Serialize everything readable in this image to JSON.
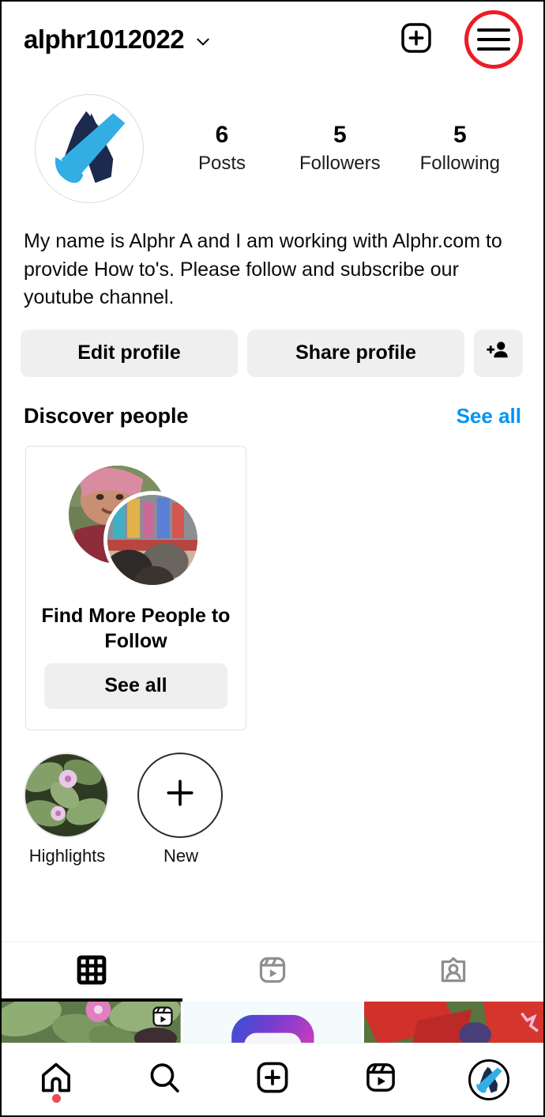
{
  "header": {
    "username": "alphr1012022",
    "chevron_icon": "chevron-down-icon",
    "create_icon": "plus-square-icon",
    "menu_icon": "hamburger-menu-icon",
    "highlight_color": "#ED1C24"
  },
  "profile": {
    "avatar_icon": "alphr-logo-avatar",
    "stats": [
      {
        "value": "6",
        "label": "Posts"
      },
      {
        "value": "5",
        "label": "Followers"
      },
      {
        "value": "5",
        "label": "Following"
      }
    ],
    "bio": "My name is Alphr A and I am working with Alphr.com to provide How to's. Please follow and subscribe our youtube channel."
  },
  "actions": {
    "edit_profile": "Edit profile",
    "share_profile": "Share profile",
    "add_person_icon": "add-person-icon"
  },
  "discover": {
    "title": "Discover people",
    "see_all_link": "See all",
    "card": {
      "title": "Find More People to Follow",
      "button": "See all"
    }
  },
  "highlights": [
    {
      "label": "Highlights",
      "type": "photo"
    },
    {
      "label": "New",
      "type": "new"
    }
  ],
  "tabs": [
    {
      "name": "grid-tab",
      "icon": "grid-icon",
      "active": true
    },
    {
      "name": "reels-tab",
      "icon": "reels-icon",
      "active": false
    },
    {
      "name": "tagged-tab",
      "icon": "tagged-person-icon",
      "active": false
    }
  ],
  "posts": [
    {
      "name": "post-leaves-flower",
      "badge": "reels-badge-icon"
    },
    {
      "name": "post-gradient-graphic",
      "badge": ""
    },
    {
      "name": "post-red-flowers",
      "badge": ""
    }
  ],
  "bottom_nav": [
    {
      "name": "home-nav-item",
      "icon": "home-icon",
      "badge": true
    },
    {
      "name": "search-nav-item",
      "icon": "search-icon",
      "badge": false
    },
    {
      "name": "create-nav-item",
      "icon": "plus-square-icon",
      "badge": false
    },
    {
      "name": "reels-nav-item",
      "icon": "reels-icon",
      "badge": false
    },
    {
      "name": "profile-nav-item",
      "icon": "profile-avatar-icon",
      "badge": false
    }
  ],
  "colors": {
    "link_blue": "#0095F6",
    "logo_navy": "#1B2A4E",
    "logo_blue": "#32AEE5",
    "button_gray": "#efefef",
    "notification_red": "#ED4956"
  }
}
